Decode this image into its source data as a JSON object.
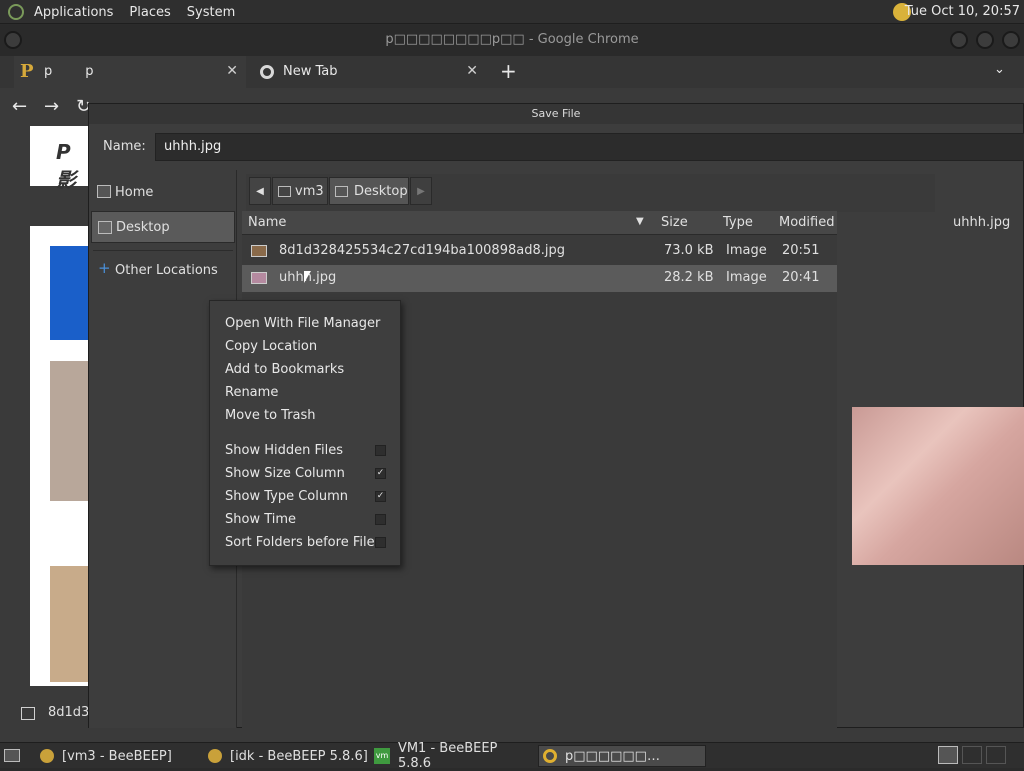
{
  "top_panel": {
    "menus": [
      "Applications",
      "Places",
      "System"
    ],
    "clock": "Tue Oct 10, 20:57"
  },
  "chrome": {
    "window_title": "p□□□□□□□□p□□ - Google Chrome",
    "tabs": [
      {
        "label": "p        p"
      },
      {
        "label": "New Tab"
      }
    ],
    "new_tab_label": "+",
    "page_heading": "P影",
    "download_item": "8d1d3"
  },
  "dialog": {
    "title": "Save File",
    "name_label": "Name:",
    "name_value": "uhhh.jpg",
    "sidebar": [
      {
        "label": "Home",
        "icon": "home-folder-icon"
      },
      {
        "label": "Desktop",
        "icon": "desktop-folder-icon",
        "selected": true
      },
      {
        "label": "Other Locations",
        "icon": "plus-icon"
      }
    ],
    "path": [
      "vm3",
      "Desktop"
    ],
    "columns": [
      "Name",
      "Size",
      "Type",
      "Modified"
    ],
    "files": [
      {
        "name": "8d1d328425534c27cd194ba100898ad8.jpg",
        "size": "73.0 kB",
        "type": "Image",
        "modified": "20:51"
      },
      {
        "name": "uhhh.jpg",
        "size": "28.2 kB",
        "type": "Image",
        "modified": "20:41",
        "selected": true
      }
    ],
    "preview_name": "uhhh.jpg"
  },
  "context_menu": {
    "actions": [
      "Open With File Manager",
      "Copy Location",
      "Add to Bookmarks",
      "Rename",
      "Move to Trash"
    ],
    "toggles": [
      {
        "label": "Show Hidden Files",
        "checked": false
      },
      {
        "label": "Show Size Column",
        "checked": true
      },
      {
        "label": "Show Type Column",
        "checked": true
      },
      {
        "label": "Show Time",
        "checked": false
      },
      {
        "label": "Sort Folders before Files",
        "checked": false
      }
    ]
  },
  "taskbar": {
    "items": [
      {
        "label": "[vm3 - BeeBEEP]"
      },
      {
        "label": "[idk - BeeBEEP 5.8.6]"
      },
      {
        "label": "VM1 - BeeBEEP 5.8.6"
      },
      {
        "label": "p□□□□□□…"
      }
    ]
  }
}
